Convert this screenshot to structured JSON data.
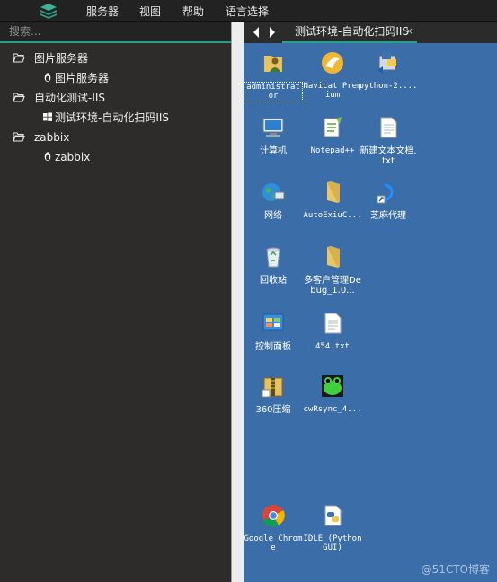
{
  "menubar": {
    "items": [
      "服务器",
      "视图",
      "帮助",
      "语言选择"
    ]
  },
  "search": {
    "placeholder": "搜索..."
  },
  "tree": [
    {
      "type": "group",
      "label": "图片服务器"
    },
    {
      "type": "leaf",
      "label": "图片服务器",
      "os": "linux"
    },
    {
      "type": "group",
      "label": "自动化测试-IIS"
    },
    {
      "type": "leaf",
      "label": "测试环境-自动化扫码IIS",
      "os": "windows"
    },
    {
      "type": "group",
      "label": "zabbix"
    },
    {
      "type": "leaf",
      "label": "zabbix",
      "os": "linux"
    }
  ],
  "tab": {
    "label": "测试环境-自动化扫码IIS",
    "close": "×"
  },
  "desktop_icons": [
    {
      "label": "administrator",
      "icon": "user-folder-icon"
    },
    {
      "label": "Navicat Premium",
      "icon": "navicat-icon"
    },
    {
      "label": "python-2....",
      "icon": "python-installer-icon"
    },
    {
      "label": "计算机",
      "icon": "computer-icon"
    },
    {
      "label": "Notepad++",
      "icon": "notepad-plus-icon"
    },
    {
      "label": "新建文本文档.txt",
      "icon": "text-file-icon"
    },
    {
      "label": "网络",
      "icon": "network-icon"
    },
    {
      "label": "AutoExiuC...",
      "icon": "folder-icon"
    },
    {
      "label": "芝麻代理",
      "icon": "shortcut-app-icon"
    },
    {
      "label": "回收站",
      "icon": "recycle-bin-icon"
    },
    {
      "label": "多客户管理Debug_1.0...",
      "icon": "folder-icon"
    },
    {
      "label": "控制面板",
      "icon": "control-panel-icon"
    },
    {
      "label": "454.txt",
      "icon": "text-file-icon"
    },
    {
      "label": "360压缩",
      "icon": "archive-icon"
    },
    {
      "label": "cwRsync_4...",
      "icon": "frog-icon"
    },
    {
      "label": "Google Chrome",
      "icon": "chrome-icon"
    },
    {
      "label": "IDLE (Python GUI)",
      "icon": "python-idle-icon"
    }
  ],
  "watermark": "@51CTO博客",
  "colors": {
    "accent": "#27a085",
    "desktop_bg": "#3b6ea8",
    "panel_bg": "#2e2c2b"
  }
}
